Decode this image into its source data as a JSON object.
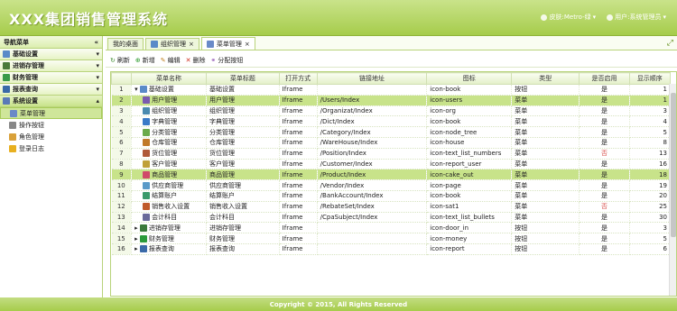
{
  "header": {
    "title": "XXX集团销售管理系统",
    "theme_label": "皮肤:Metro-绿",
    "user_label": "用户:系统管理员"
  },
  "sidebar": {
    "title": "导航菜单",
    "collapse_icon": "«",
    "groups": [
      {
        "label": "基础设置"
      },
      {
        "label": "进销存管理"
      },
      {
        "label": "财务管理"
      },
      {
        "label": "报表查询"
      },
      {
        "label": "系统设置"
      }
    ],
    "items": [
      {
        "label": "菜单管理"
      },
      {
        "label": "操作按钮"
      },
      {
        "label": "角色管理"
      },
      {
        "label": "登录日志"
      }
    ]
  },
  "tabs": [
    {
      "label": "我的桌面"
    },
    {
      "label": "组织管理"
    },
    {
      "label": "菜单管理"
    }
  ],
  "toolbar": {
    "refresh": "刷新",
    "add": "新增",
    "edit": "编辑",
    "delete": "删除",
    "assign": "分配按钮"
  },
  "grid": {
    "columns": [
      "菜单名称",
      "菜单标题",
      "打开方式",
      "链接地址",
      "图标",
      "类型",
      "是否启用",
      "显示顺序"
    ],
    "rows": [
      {
        "num": "1",
        "name": "基础设置",
        "title": "基础设置",
        "open": "Iframe",
        "url": "",
        "icon": "icon-book",
        "type": "按钮",
        "enabled": "是",
        "order": "1"
      },
      {
        "num": "2",
        "name": "用户管理",
        "title": "用户管理",
        "open": "Iframe",
        "url": "/Users/Index",
        "icon": "icon-users",
        "type": "菜单",
        "enabled": "是",
        "order": "1"
      },
      {
        "num": "3",
        "name": "组织管理",
        "title": "组织管理",
        "open": "Iframe",
        "url": "/Organizat/Index",
        "icon": "icon-org",
        "type": "菜单",
        "enabled": "是",
        "order": "3"
      },
      {
        "num": "4",
        "name": "字典管理",
        "title": "字典管理",
        "open": "Iframe",
        "url": "/Dict/Index",
        "icon": "icon-book",
        "type": "菜单",
        "enabled": "是",
        "order": "4"
      },
      {
        "num": "5",
        "name": "分类管理",
        "title": "分类管理",
        "open": "Iframe",
        "url": "/Category/Index",
        "icon": "icon-node_tree",
        "type": "菜单",
        "enabled": "是",
        "order": "5"
      },
      {
        "num": "6",
        "name": "仓库管理",
        "title": "仓库管理",
        "open": "Iframe",
        "url": "/WareHouse/Index",
        "icon": "icon-house",
        "type": "菜单",
        "enabled": "是",
        "order": "8"
      },
      {
        "num": "7",
        "name": "货位管理",
        "title": "货位管理",
        "open": "Iframe",
        "url": "/Position/Index",
        "icon": "icon-text_list_numbers",
        "type": "菜单",
        "enabled": "否",
        "order": "13"
      },
      {
        "num": "8",
        "name": "客户管理",
        "title": "客户管理",
        "open": "Iframe",
        "url": "/Customer/Index",
        "icon": "icon-report_user",
        "type": "菜单",
        "enabled": "是",
        "order": "16"
      },
      {
        "num": "9",
        "name": "商品管理",
        "title": "商品管理",
        "open": "Iframe",
        "url": "/Product/Index",
        "icon": "icon-cake_out",
        "type": "菜单",
        "enabled": "是",
        "order": "18"
      },
      {
        "num": "10",
        "name": "供应商管理",
        "title": "供应商管理",
        "open": "Iframe",
        "url": "/Vendor/Index",
        "icon": "icon-page",
        "type": "菜单",
        "enabled": "是",
        "order": "19"
      },
      {
        "num": "11",
        "name": "结算账户",
        "title": "结算账户",
        "open": "Iframe",
        "url": "/BankAccount/Index",
        "icon": "icon-book",
        "type": "菜单",
        "enabled": "是",
        "order": "20"
      },
      {
        "num": "12",
        "name": "销售收入设置",
        "title": "销售收入设置",
        "open": "Iframe",
        "url": "/RebateSet/Index",
        "icon": "icon-sat1",
        "type": "菜单",
        "enabled": "否",
        "order": "25"
      },
      {
        "num": "13",
        "name": "会计科目",
        "title": "会计科目",
        "open": "Iframe",
        "url": "/CpaSubject/Index",
        "icon": "icon-text_list_bullets",
        "type": "菜单",
        "enabled": "是",
        "order": "30"
      },
      {
        "num": "14",
        "name": "进销存管理",
        "title": "进销存管理",
        "open": "Iframe",
        "url": "",
        "icon": "icon-door_in",
        "type": "按钮",
        "enabled": "是",
        "order": "3"
      },
      {
        "num": "15",
        "name": "财务管理",
        "title": "财务管理",
        "open": "Iframe",
        "url": "",
        "icon": "icon-money",
        "type": "按钮",
        "enabled": "是",
        "order": "5"
      },
      {
        "num": "16",
        "name": "报表查询",
        "title": "报表查询",
        "open": "Iframe",
        "url": "",
        "icon": "icon-report",
        "type": "按钮",
        "enabled": "是",
        "order": "6"
      }
    ]
  },
  "footer": {
    "text": "Copyright © 2015, All Rights Reserved"
  },
  "colors": {
    "accent": "#a6cc4b",
    "selected_row": "#c8e38a",
    "no_value": "#d9534f"
  }
}
